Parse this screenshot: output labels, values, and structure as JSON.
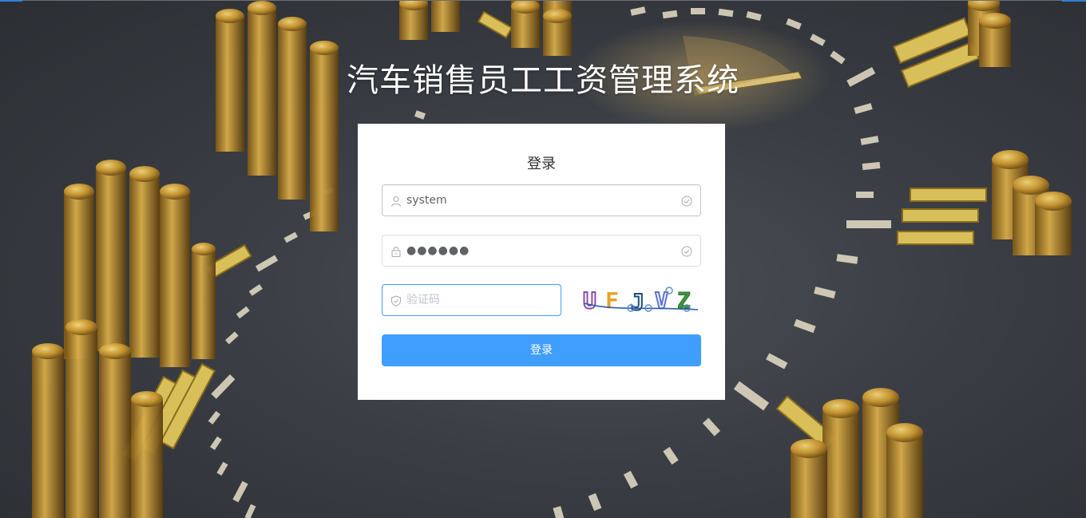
{
  "app": {
    "title": "汽车销售员工工资管理系统"
  },
  "login_panel": {
    "heading": "登录",
    "username": {
      "value": "system",
      "icon": "user-icon",
      "status_icon": "circle-check-icon"
    },
    "password": {
      "value": "●●●●●●",
      "icon": "lock-icon",
      "status_icon": "circle-check-icon"
    },
    "captcha": {
      "placeholder": "验证码",
      "icon": "shield-icon",
      "image_text": "UFJVZ"
    },
    "submit_label": "登录"
  },
  "colors": {
    "primary": "#409eff",
    "panel_bg": "#ffffff",
    "background": "#3a3e44",
    "accent_gold": "#c9a84a"
  }
}
